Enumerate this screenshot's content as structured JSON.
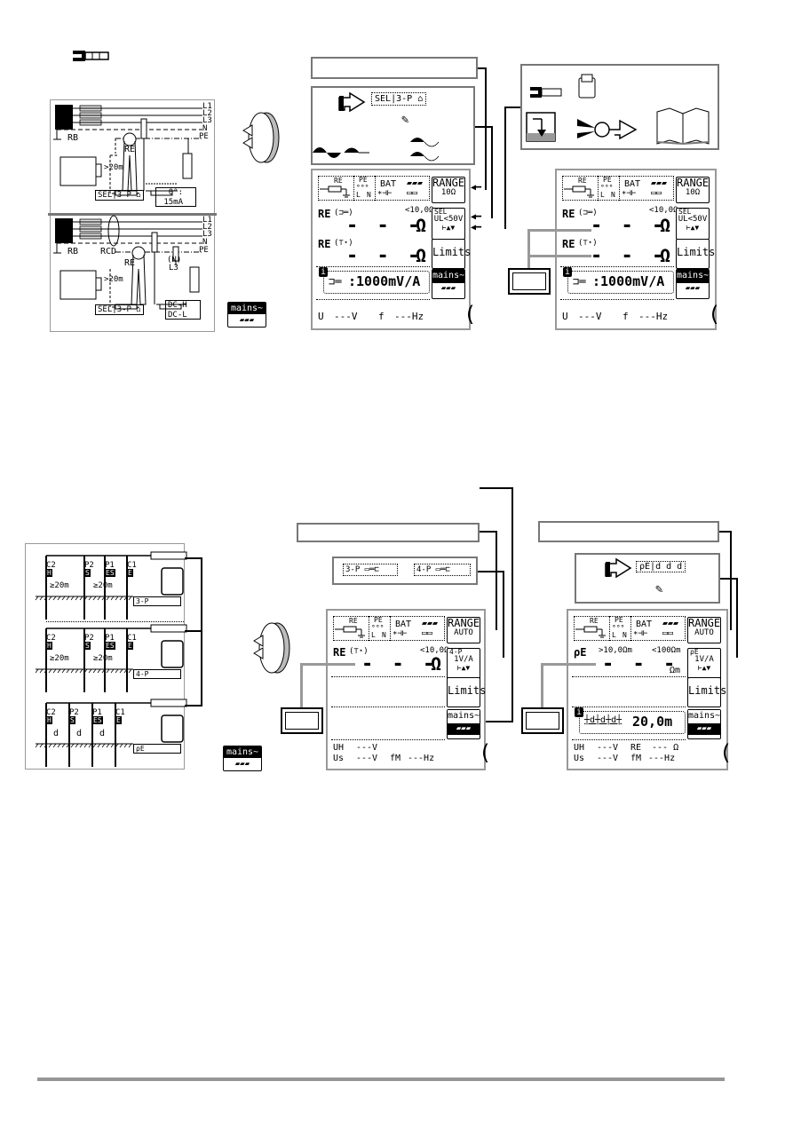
{
  "colors": {
    "frame": "#777777",
    "rule": "#969696",
    "arrow_gray": "#999999",
    "ink": "#000000"
  },
  "top_section": {
    "clamp_icon": "clamp-meter-icon",
    "diagram_3p_clamp": {
      "lines": [
        "L1",
        "L2",
        "L3",
        "N",
        "PE"
      ],
      "rb": "RB",
      "re": "RE",
      "distance": ">20m",
      "sel_label": "SEL",
      "mode": "3-P",
      "setting_top": "0°:",
      "setting_bottom": "15mA"
    },
    "diagram_rcd": {
      "lines": [
        "L1",
        "L2",
        "L3",
        "N",
        "PE"
      ],
      "rb": "RB",
      "rcd": "RCD",
      "re": "RE",
      "neutral": "(N)",
      "l3": "L3",
      "distance": ">20m",
      "sel_label": "SEL",
      "mode": "3-P",
      "dc_h": "DC-H",
      "dc_l": "DC-L"
    },
    "rotary_icon": "rotary-switch-icon",
    "mains_button": {
      "top": "mains~",
      "bottom": "battery"
    },
    "select_panel": {
      "sel_label": "SEL",
      "mode": "3-P"
    },
    "info_panel": {
      "icons": [
        "clamp-icon",
        "adapter-icon",
        "ground-spike-icon",
        "clamp-open-icon",
        "arrow-icon",
        "manual-book-icon"
      ]
    },
    "lcd_left": {
      "re_label": "RE",
      "status_bat": "BAT",
      "status_pe": "PE",
      "status_l": "L",
      "status_n": "N",
      "range_label": "RANGE",
      "range_value": "10Ω",
      "row1_label": "RE",
      "row1_limit": "<10,0Ω",
      "row1_value": "- - -",
      "row1_unit": "Ω",
      "sel_key_top": "SEL",
      "sel_key_mid": "UL<50V",
      "row2_label": "RE",
      "row2_value": "- - -",
      "row2_unit": "Ω",
      "limits": "Limits",
      "info_value": ":1000mV/A",
      "mains": "mains~",
      "u_label": "U",
      "u_value": "---V",
      "f_label": "f",
      "f_value": "---Hz"
    },
    "lcd_right": {
      "re_label": "RE",
      "status_bat": "BAT",
      "status_pe": "PE",
      "status_l": "L",
      "status_n": "N",
      "range_label": "RANGE",
      "range_value": "10Ω",
      "row1_label": "RE",
      "row1_limit": "<10,0Ω",
      "row1_value": "- - -",
      "row1_unit": "Ω",
      "sel_key_top": "SEL",
      "sel_key_mid": "UL<50V",
      "row2_label": "RE",
      "row2_value": "- - -",
      "row2_unit": "Ω",
      "limits": "Limits",
      "info_value": ":1000mV/A",
      "mains": "mains~",
      "u_label": "U",
      "u_value": "---V",
      "f_label": "f",
      "f_value": "---Hz"
    }
  },
  "bottom_section": {
    "diagram_3p": {
      "c2": "C2",
      "h": "H",
      "p2": "P2",
      "s": "S",
      "p1": "P1",
      "es": "ES",
      "c1": "C1",
      "e": "E",
      "d1": "≥20m",
      "d2": "≥20m",
      "mode": "3-P"
    },
    "diagram_4p": {
      "c2": "C2",
      "h": "H",
      "p2": "P2",
      "s": "S",
      "p1": "P1",
      "es": "ES",
      "c1": "C1",
      "e": "E",
      "d1": "≥20m",
      "d2": "≥20m",
      "mode": "4-P"
    },
    "diagram_rho": {
      "c2": "C2",
      "h": "H",
      "p2": "P2",
      "s": "S",
      "p1": "P1",
      "es": "ES",
      "c1": "C1",
      "e": "E",
      "d": "d",
      "mode": "ρE"
    },
    "mode_panel": {
      "opt1": "3-P",
      "opt2": "4-P"
    },
    "rho_panel": {
      "mode": "ρE",
      "pattern": "d d d"
    },
    "mains_button": {
      "top": "mains~",
      "bottom": "battery"
    },
    "lcd_left": {
      "re_label": "RE",
      "status_bat": "BAT",
      "status_pe": "PE",
      "status_l": "L",
      "status_n": "N",
      "range_label": "RANGE",
      "range_value": "AUTO",
      "row1_label": "RE",
      "row1_limit": "<10,0Ω",
      "row1_value": "- - -",
      "row1_unit": "Ω",
      "mode_key_top": "4-P",
      "mode_key_mid": "1V/A",
      "limits": "Limits",
      "mains": "mains~",
      "uh_label": "UH",
      "uh_value": "---V",
      "us_label": "Us",
      "us_value": "---V",
      "fm_label": "fM",
      "fm_value": "---Hz"
    },
    "lcd_right": {
      "re_label": "RE",
      "status_bat": "BAT",
      "status_pe": "PE",
      "status_l": "L",
      "status_n": "N",
      "range_label": "RANGE",
      "range_value": "AUTO",
      "row1_label": "ρE",
      "row1_limit_low": ">10,0Ωm",
      "row1_limit_high": "<100Ωm",
      "row1_value": "- - -",
      "row1_unit": "Ωm",
      "mode_key_top": "ρE",
      "mode_key_mid": "1V/A",
      "limits": "Limits",
      "info_value": "20,0m",
      "mains": "mains~",
      "uh_label": "UH",
      "uh_value": "---V",
      "re2_label": "RE",
      "re2_value": "--- Ω",
      "us_label": "Us",
      "us_value": "---V",
      "fm_label": "fM",
      "fm_value": "---Hz"
    }
  }
}
